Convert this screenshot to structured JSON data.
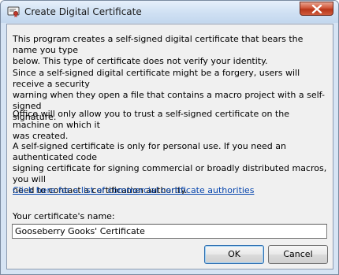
{
  "window": {
    "title": "Create Digital Certificate",
    "title_icon": "certificate-icon",
    "close_icon": "close-icon"
  },
  "body": {
    "paragraph_1": "This program creates a self-signed digital certificate that bears the name you type\nbelow. This type of certificate does not verify your identity.",
    "paragraph_2": "Since a self-signed digital certificate might be a forgery, users will receive a security\nwarning when they open a file that contains a macro project with a self-signed\nsignature.",
    "paragraph_3": "Office will only allow you to trust a self-signed certificate on the machine on which it\nwas created.",
    "paragraph_4": "A self-signed certificate is only for personal use. If you need an authenticated code\nsigning certificate for signing commercial or broadly distributed macros, you will\nneed to contact a certification authority.",
    "link_text": "Click here for a list of commercial certificate authorities"
  },
  "form": {
    "name_label": "Your certificate's name:",
    "name_value": "Gooseberry Gooks' Certificate"
  },
  "buttons": {
    "ok_label": "OK",
    "cancel_label": "Cancel"
  },
  "colors": {
    "link": "#0645ad",
    "close_button": "#c4442a",
    "title_bar": "#cfe0f3"
  }
}
